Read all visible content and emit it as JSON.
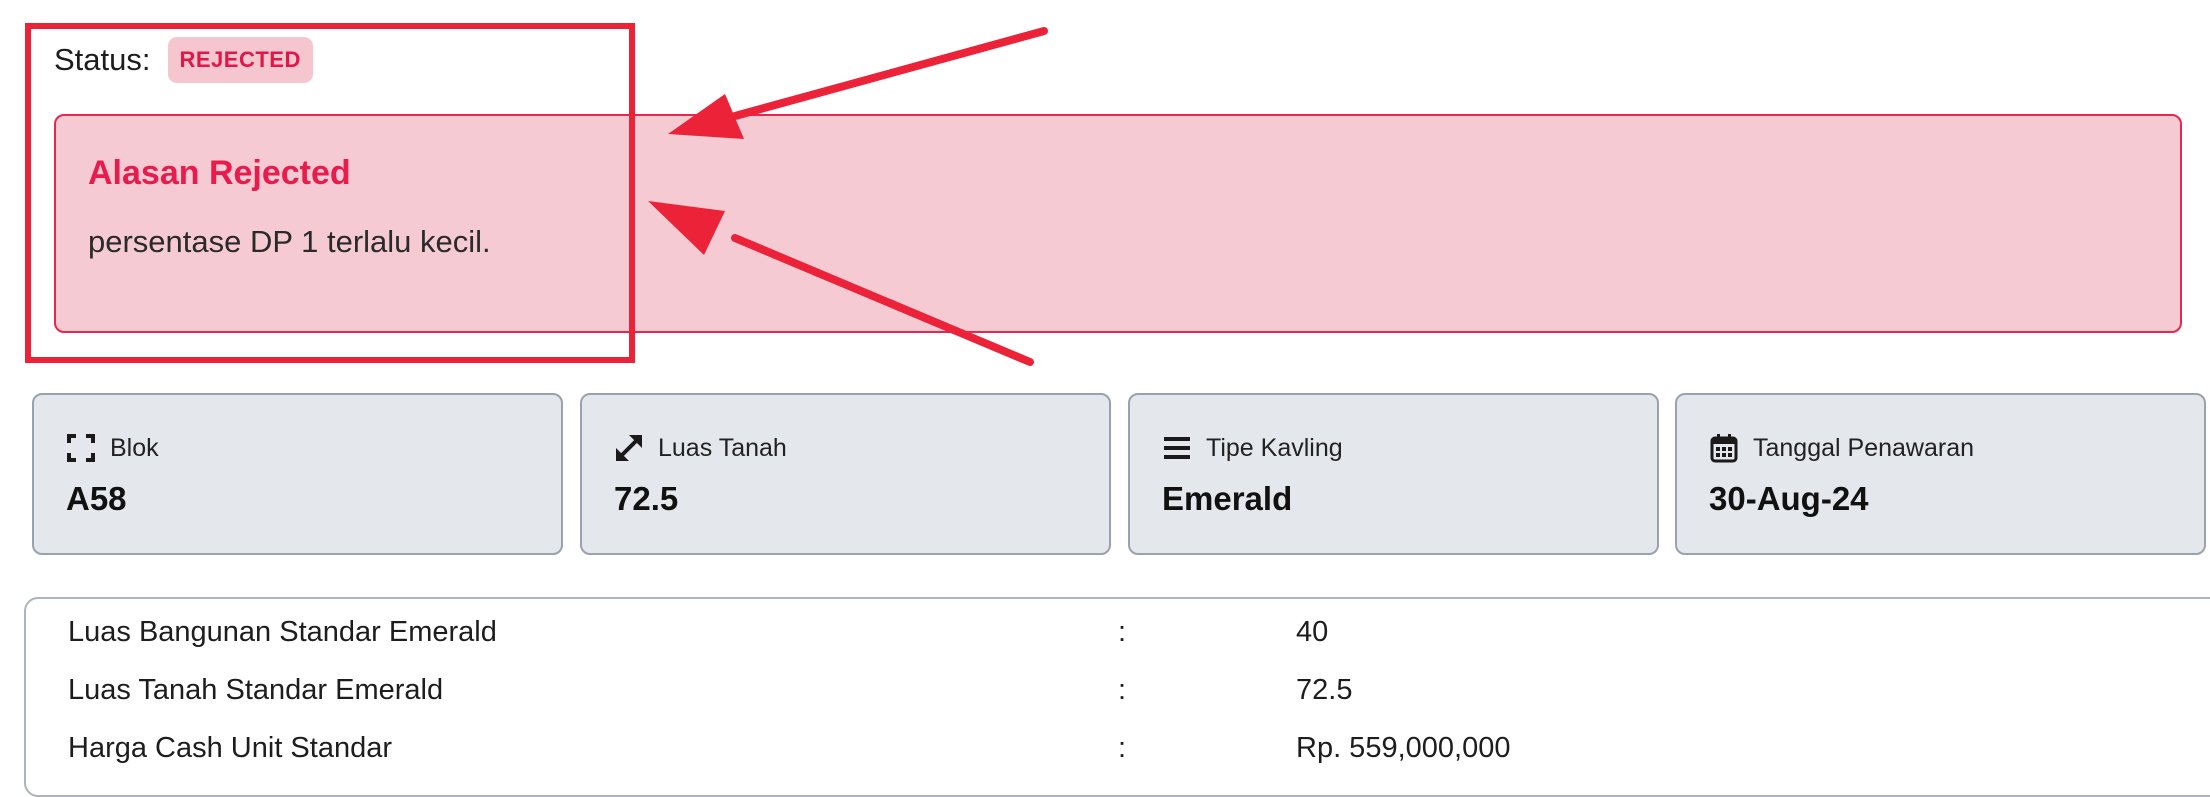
{
  "status": {
    "label": "Status:",
    "badge": "REJECTED"
  },
  "rejection_alert": {
    "title": "Alasan Rejected",
    "reason": "persentase DP 1 terlalu kecil."
  },
  "cards": [
    {
      "icon": "expand-corners-icon",
      "label": "Blok",
      "value": "A58"
    },
    {
      "icon": "resize-arrows-icon",
      "label": "Luas Tanah",
      "value": "72.5"
    },
    {
      "icon": "list-lines-icon",
      "label": "Tipe Kavling",
      "value": "Emerald"
    },
    {
      "icon": "calendar-icon",
      "label": "Tanggal Penawaran",
      "value": "30-Aug-24"
    }
  ],
  "details": {
    "separator": ":",
    "rows": [
      {
        "label": "Luas Bangunan Standar Emerald",
        "value": "40"
      },
      {
        "label": "Luas Tanah Standar Emerald",
        "value": "72.5"
      },
      {
        "label": "Harga Cash Unit Standar",
        "value": "Rp. 559,000,000"
      }
    ]
  },
  "colors": {
    "reject_accent": "#e91b4d",
    "reject_background": "#f6cad3",
    "annotation_red": "#ec2338",
    "card_background": "#e4e7ec"
  }
}
